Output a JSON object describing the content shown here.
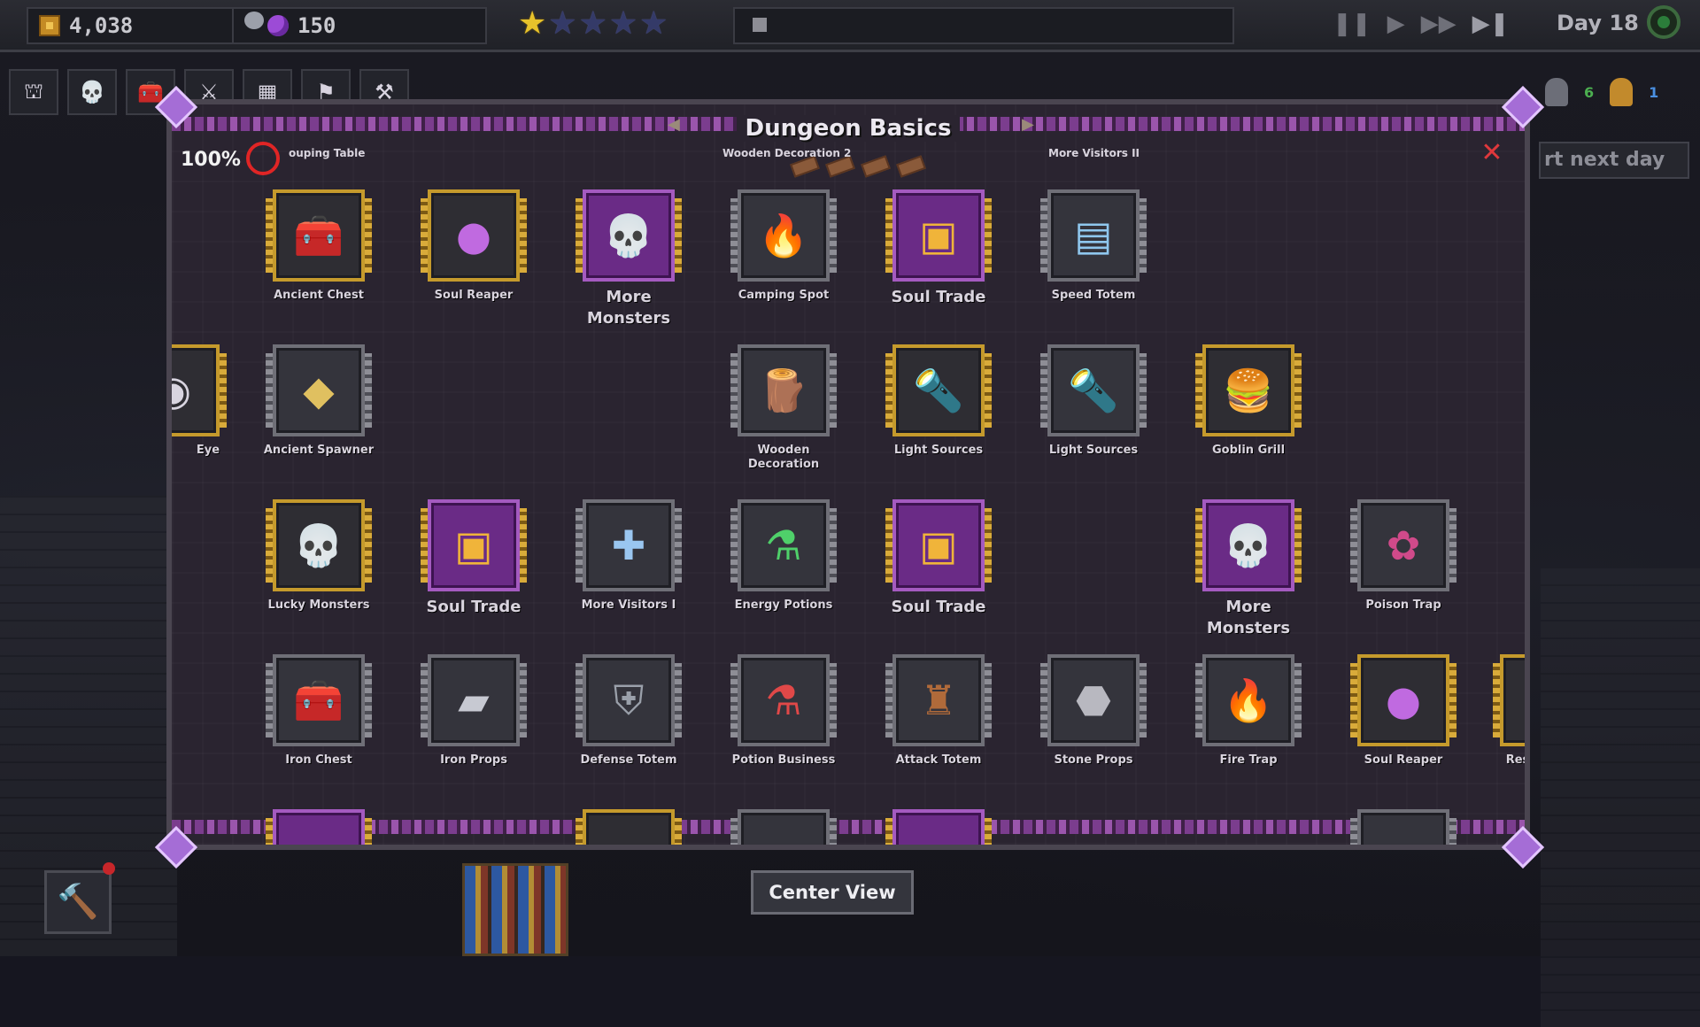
{
  "topbar": {
    "gold": "4,038",
    "souls": "150",
    "stars_filled": 1,
    "stars_total": 5,
    "day": "Day 18"
  },
  "sidebar_staff": {
    "count_a": "6",
    "count_b": "1"
  },
  "next_day_label": "rt next day",
  "dialog": {
    "title": "Dungeon Basics",
    "zoom": "100%",
    "top_labels": {
      "left": "ouping Table",
      "center": "Wooden Decoration 2",
      "right": "More Visitors II"
    },
    "nodes": {
      "ancient_chest": "Ancient Chest",
      "soul_reaper_1": "Soul Reaper",
      "more_monsters_1": "More Monsters",
      "camping_spot": "Camping Spot",
      "soul_trade_1": "Soul Trade",
      "speed_totem": "Speed Totem",
      "eye": "Eye",
      "ancient_spawner": "Ancient Spawner",
      "wooden_decoration": "Wooden Decoration",
      "light_sources_1": "Light Sources",
      "light_sources_2": "Light Sources",
      "goblin_grill": "Goblin Grill",
      "lucky_monsters": "Lucky Monsters",
      "soul_trade_2": "Soul Trade",
      "more_visitors_1": "More Visitors I",
      "energy_potions": "Energy Potions",
      "soul_trade_3": "Soul Trade",
      "more_monsters_2": "More Monsters",
      "poison_trap": "Poison Trap",
      "iron_chest": "Iron Chest",
      "iron_props": "Iron Props",
      "defense_totem": "Defense Totem",
      "potion_business": "Potion Business",
      "attack_totem": "Attack Totem",
      "stone_props": "Stone Props",
      "fire_trap": "Fire Trap",
      "soul_reaper_2": "Soul Reaper",
      "res_cut": "Res"
    }
  },
  "center_view": "Center View",
  "icons": {
    "gold": "coin-icon",
    "souls": "soul-icon",
    "close": "close-icon",
    "cycle": "day-cycle-icon"
  },
  "colors": {
    "accent_purple": "#7b3d8e",
    "star_gold": "#e7c22b",
    "close_red": "#e0383c"
  }
}
